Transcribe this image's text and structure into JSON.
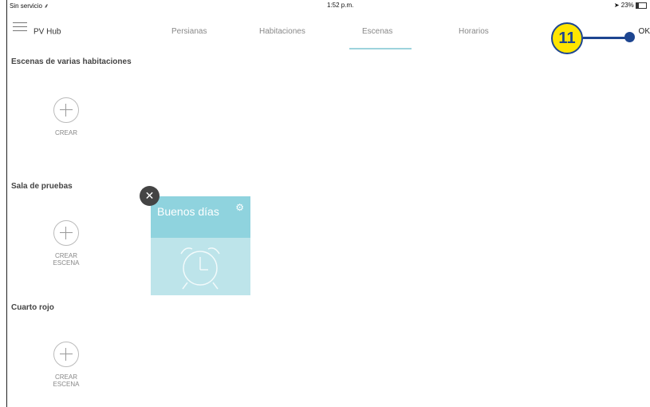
{
  "status_bar": {
    "carrier": "Sin servicio",
    "time": "1:52 p.m.",
    "battery": "23%"
  },
  "nav": {
    "hub_name": "PV Hub",
    "tabs": [
      "Persianas",
      "Habitaciones",
      "Escenas",
      "Horarios"
    ],
    "active_tab": "Escenas",
    "ok_label": "OK"
  },
  "callout": {
    "number": "11"
  },
  "sections": [
    {
      "title": "Escenas de varias habitaciones",
      "add_label_1": "CREAR",
      "add_label_2": ""
    },
    {
      "title": "Sala de pruebas",
      "add_label_1": "CREAR",
      "add_label_2": "ESCENA"
    },
    {
      "title": "Cuarto rojo",
      "add_label_1": "CREAR",
      "add_label_2": "ESCENA"
    }
  ],
  "scene_card": {
    "title": "Buenos días",
    "icon": "alarm-clock-icon"
  },
  "colors": {
    "accent": "#8fd3de",
    "accent_light": "#bde4ea",
    "callout_fill": "#ffe500",
    "callout_stroke": "#1d4590"
  }
}
